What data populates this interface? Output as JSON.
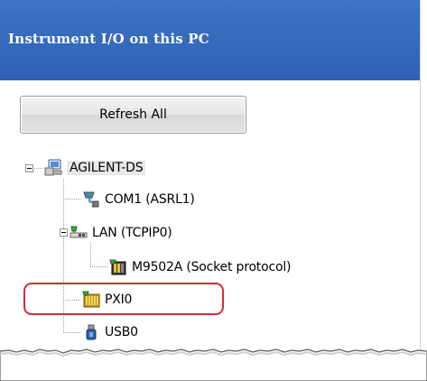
{
  "window": {
    "header_title": "Instrument I/O on this PC"
  },
  "toolbar": {
    "refresh_label": "Refresh All"
  },
  "tree": {
    "root": {
      "label": "AGILENT-DS",
      "icon": "computer-icon",
      "expanded": true
    },
    "items": [
      {
        "label": "COM1 (ASRL1)",
        "icon": "serial-port-icon"
      },
      {
        "label": "LAN (TCPIP0)",
        "icon": "lan-network-icon",
        "expanded": true
      },
      {
        "label": "M9502A (Socket protocol)",
        "icon": "instrument-chassis-icon"
      },
      {
        "label": "PXI0",
        "icon": "pxi-chassis-icon"
      },
      {
        "label": "USB0",
        "icon": "usb-icon"
      }
    ]
  },
  "annotation": {
    "highlight_color": "#d62a35"
  },
  "colors": {
    "header": "#3366bb",
    "header_text": "#ffffff"
  }
}
